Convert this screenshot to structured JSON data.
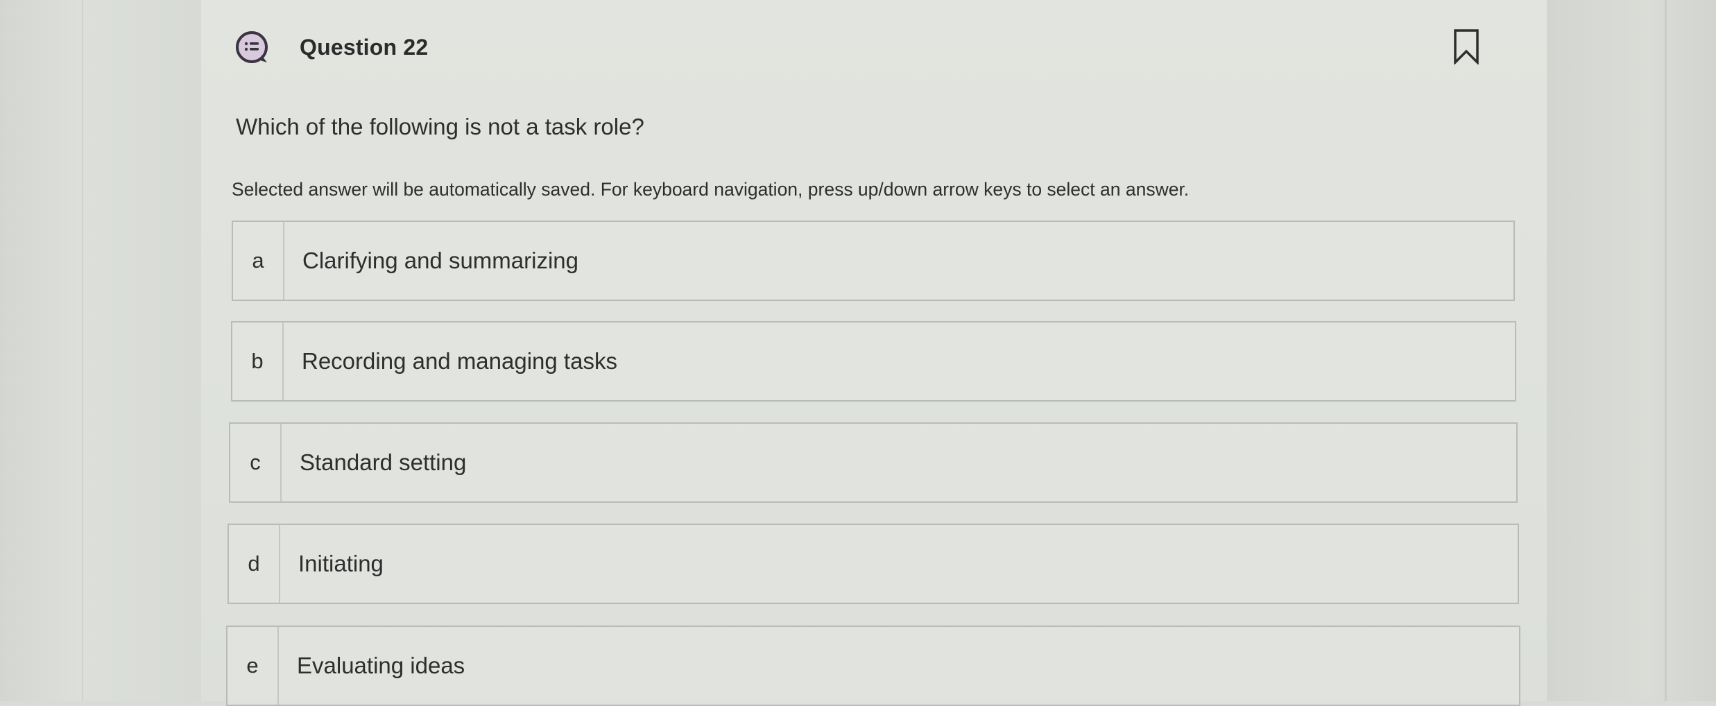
{
  "question": {
    "title": "Question 22",
    "prompt": "Which of the following is not a task role?",
    "instructions": "Selected answer will be automatically saved. For keyboard navigation, press up/down arrow keys to select an answer."
  },
  "icons": {
    "question_icon": "question-list-icon",
    "bookmark_icon": "bookmark-icon"
  },
  "options": [
    {
      "letter": "a",
      "text": "Clarifying and summarizing"
    },
    {
      "letter": "b",
      "text": "Recording and managing tasks"
    },
    {
      "letter": "c",
      "text": "Standard setting"
    },
    {
      "letter": "d",
      "text": "Initiating"
    },
    {
      "letter": "e",
      "text": "Evaluating ideas"
    }
  ],
  "colors": {
    "background": "#d8dbd6",
    "card": "#e0e3de",
    "text": "#2d2f2e",
    "icon_accent": "#3a3340",
    "border": "#b8bbb6"
  }
}
